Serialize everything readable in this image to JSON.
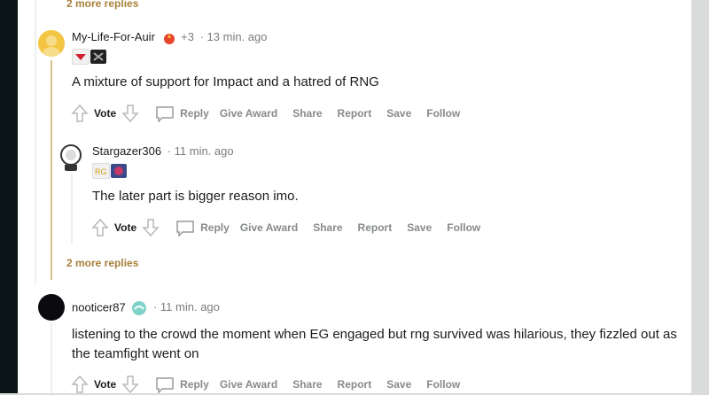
{
  "thread": {
    "more_replies_top": "2 more replies",
    "more_replies_mid": "2 more replies"
  },
  "comments": [
    {
      "username": "My-Life-For-Auir",
      "extra": "+3",
      "time": "· 13 min. ago",
      "body": "A mixture of support for Impact and a hatred of RNG",
      "actions": {
        "vote": "Vote",
        "reply": "Reply",
        "award": "Give Award",
        "share": "Share",
        "report": "Report",
        "save": "Save",
        "follow": "Follow"
      }
    },
    {
      "username": "Stargazer306",
      "time": "· 11 min. ago",
      "body": "The later part is bigger reason imo.",
      "actions": {
        "vote": "Vote",
        "reply": "Reply",
        "award": "Give Award",
        "share": "Share",
        "report": "Report",
        "save": "Save",
        "follow": "Follow"
      }
    },
    {
      "username": "nooticer87",
      "time": "· 11 min. ago",
      "body": "listening to the crowd the moment when EG engaged but rng survived was hilarious, they fizzled out as the teamfight went on",
      "actions": {
        "vote": "Vote",
        "reply": "Reply",
        "award": "Give Award",
        "share": "Share",
        "report": "Report",
        "save": "Save",
        "follow": "Follow"
      }
    }
  ],
  "colors": {
    "accent_thread": "#d7c08f",
    "more_replies": "#a8813b",
    "meta": "#7c7c7c",
    "action": "#878a8c"
  }
}
